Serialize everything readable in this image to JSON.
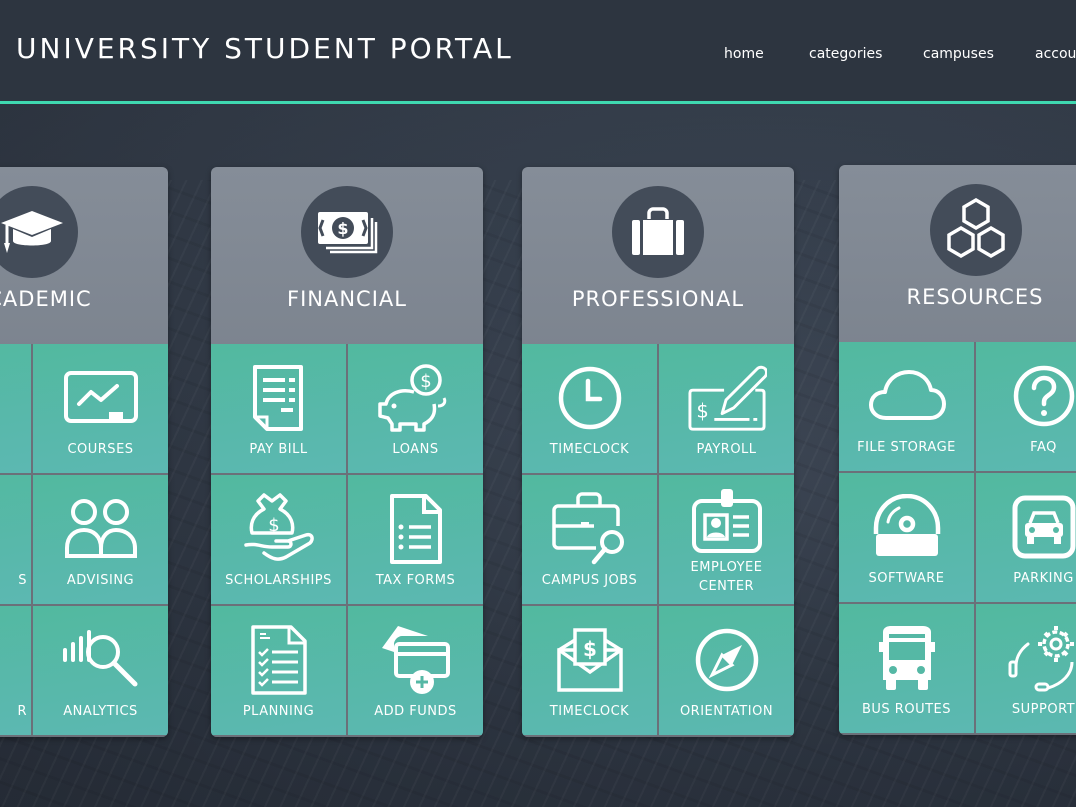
{
  "header": {
    "title": "UNIVERSITY STUDENT PORTAL",
    "nav": [
      "home",
      "categories",
      "campuses",
      "account"
    ],
    "accent_color": "#3fd8b0"
  },
  "categories": [
    {
      "title": "ACADEMIC",
      "icon": "graduation-cap-icon",
      "tiles": [
        {
          "label": "",
          "icon": ""
        },
        {
          "label": "COURSES",
          "icon": "chart-board-icon"
        },
        {
          "label": "S",
          "icon": ""
        },
        {
          "label": "ADVISING",
          "icon": "people-icon"
        },
        {
          "label": "R",
          "icon": ""
        },
        {
          "label": "ANALYTICS",
          "icon": "analytics-search-icon"
        }
      ]
    },
    {
      "title": "FINANCIAL",
      "icon": "money-stack-icon",
      "tiles": [
        {
          "label": "PAY BILL",
          "icon": "bill-icon"
        },
        {
          "label": "LOANS",
          "icon": "piggy-bank-icon"
        },
        {
          "label": "SCHOLARSHIPS",
          "icon": "money-bag-hand-icon"
        },
        {
          "label": "TAX FORMS",
          "icon": "document-list-icon"
        },
        {
          "label": "PLANNING",
          "icon": "checklist-icon"
        },
        {
          "label": "ADD FUNDS",
          "icon": "card-add-icon"
        }
      ]
    },
    {
      "title": "PROFESSIONAL",
      "icon": "briefcase-icon",
      "tiles": [
        {
          "label": "TIMECLOCK",
          "icon": "clock-icon"
        },
        {
          "label": "PAYROLL",
          "icon": "check-sign-icon"
        },
        {
          "label": "CAMPUS JOBS",
          "icon": "briefcase-search-icon"
        },
        {
          "label": "EMPLOYEE CENTER",
          "icon": "id-badge-icon"
        },
        {
          "label": "TIMECLOCK",
          "icon": "envelope-money-icon"
        },
        {
          "label": "ORIENTATION",
          "icon": "compass-icon"
        }
      ]
    },
    {
      "title": "RESOURCES",
      "icon": "hexagons-icon",
      "tiles": [
        {
          "label": "FILE STORAGE",
          "icon": "cloud-icon"
        },
        {
          "label": "FAQ",
          "icon": "question-circle-icon"
        },
        {
          "label": "SOFTWARE",
          "icon": "disc-drive-icon"
        },
        {
          "label": "PARKING",
          "icon": "car-icon"
        },
        {
          "label": "BUS ROUTES",
          "icon": "bus-icon"
        },
        {
          "label": "SUPPORT",
          "icon": "support-gear-icon"
        }
      ]
    }
  ]
}
